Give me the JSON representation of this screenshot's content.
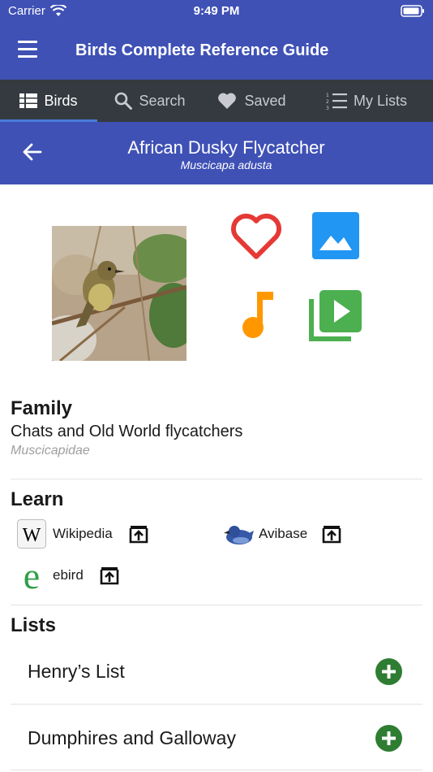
{
  "status_bar": {
    "carrier": "Carrier",
    "time": "9:49 PM"
  },
  "app_bar": {
    "title": "Birds Complete Reference Guide"
  },
  "tabs": [
    {
      "label": "Birds",
      "icon": "list-icon",
      "active": true
    },
    {
      "label": "Search",
      "icon": "search-icon",
      "active": false
    },
    {
      "label": "Saved",
      "icon": "heart-icon",
      "active": false
    },
    {
      "label": "My Lists",
      "icon": "numbered-list-icon",
      "active": false
    }
  ],
  "bird": {
    "common_name": "African Dusky Flycatcher",
    "scientific_name": "Muscicapa adusta"
  },
  "actions": [
    {
      "name": "favorite",
      "icon": "heart-outline-icon",
      "color": "#e53935"
    },
    {
      "name": "images",
      "icon": "image-icon",
      "color": "#2196f3"
    },
    {
      "name": "sound",
      "icon": "music-note-icon",
      "color": "#ff9800"
    },
    {
      "name": "video",
      "icon": "video-library-icon",
      "color": "#4caf50"
    }
  ],
  "family": {
    "heading": "Family",
    "name": "Chats and Old World flycatchers",
    "scientific": "Muscicapidae"
  },
  "learn": {
    "heading": "Learn",
    "links": [
      {
        "label": "Wikipedia",
        "icon": "wikipedia-icon"
      },
      {
        "label": "Avibase",
        "icon": "avibase-bird-icon"
      },
      {
        "label": "ebird",
        "icon": "ebird-icon"
      }
    ]
  },
  "lists": {
    "heading": "Lists",
    "items": [
      {
        "name": "Henry’s List"
      },
      {
        "name": "Dumphires and Galloway"
      }
    ]
  },
  "colors": {
    "primary": "#3f51b5",
    "tab_bar": "#343a40",
    "add_button": "#2e7d32"
  }
}
